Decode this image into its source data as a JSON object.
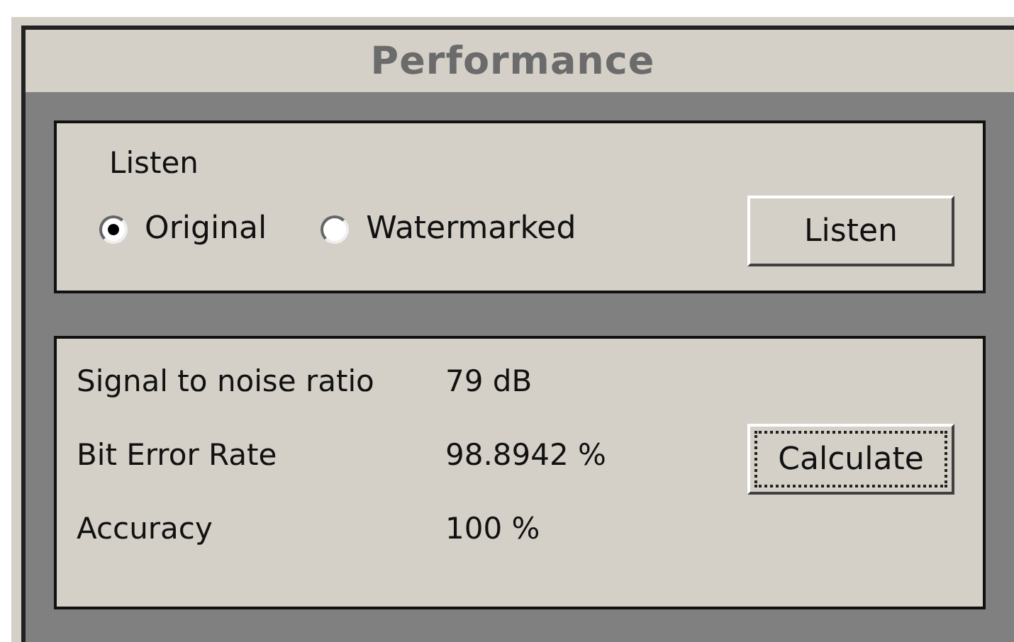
{
  "title": "Performance",
  "listen_group": {
    "label": "Listen",
    "options": [
      {
        "label": "Original",
        "selected": true
      },
      {
        "label": "Watermarked",
        "selected": false
      }
    ],
    "button": {
      "label": "Listen",
      "focused": false
    }
  },
  "results": {
    "rows": [
      {
        "label": "Signal to noise ratio",
        "value": "79 dB"
      },
      {
        "label": "Bit Error Rate",
        "value": "98.8942 %"
      },
      {
        "label": "Accuracy",
        "value": "100 %"
      }
    ],
    "button": {
      "label": "Calculate",
      "focused": true
    }
  }
}
